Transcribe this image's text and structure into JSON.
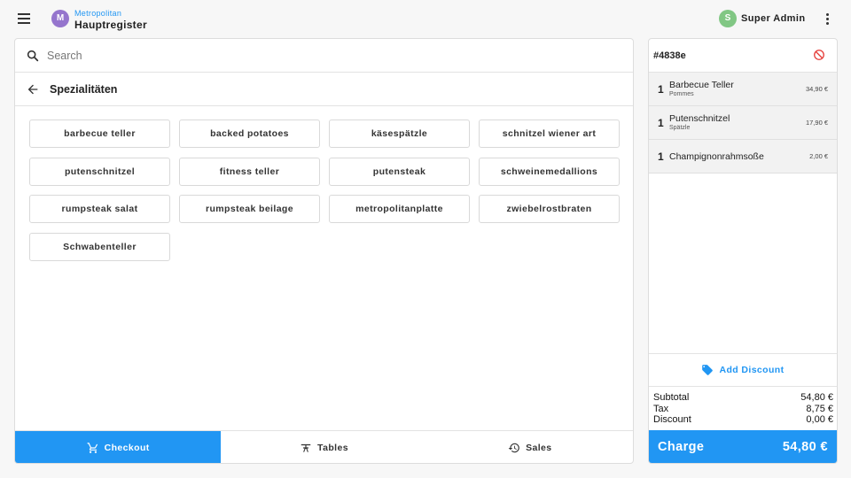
{
  "header": {
    "store_avatar": "M",
    "store_subtitle": "Metropolitan",
    "store_title": "Hauptregister",
    "user_avatar": "S",
    "user_name": "Super Admin"
  },
  "search": {
    "placeholder": "Search",
    "value": ""
  },
  "category": {
    "title": "Spezialitäten"
  },
  "products": [
    "barbecue teller",
    "backed potatoes",
    "käsespätzle",
    "schnitzel wiener art",
    "putenschnitzel",
    "fitness teller",
    "putensteak",
    "schweinemedallions",
    "rumpsteak salat",
    "rumpsteak beilage",
    "metropolitanplatte",
    "zwiebelrostbraten",
    "Schwabenteller"
  ],
  "tabs": [
    {
      "label": "Checkout",
      "icon": "cart-icon",
      "active": true
    },
    {
      "label": "Tables",
      "icon": "table-icon",
      "active": false
    },
    {
      "label": "Sales",
      "icon": "history-icon",
      "active": false
    }
  ],
  "order": {
    "id": "#4838e",
    "lines": [
      {
        "qty": "1",
        "name": "Barbecue Teller",
        "modifier": "Pommes",
        "price": "34,90 €"
      },
      {
        "qty": "1",
        "name": "Putenschnitzel",
        "modifier": "Spätzle",
        "price": "17,90 €"
      },
      {
        "qty": "1",
        "name": "Champignonrahmsoße",
        "modifier": "",
        "price": "2,00 €"
      }
    ],
    "add_discount_label": "Add Discount",
    "subtotal_label": "Subtotal",
    "subtotal": "54,80 €",
    "tax_label": "Tax",
    "tax": "8,75 €",
    "discount_label": "Discount",
    "discount": "0,00 €",
    "charge_label": "Charge",
    "charge_amount": "54,80 €"
  },
  "colors": {
    "accent": "#2196f3",
    "store_avatar": "#9575cd",
    "user_avatar": "#81c784",
    "cancel": "#e53935"
  }
}
